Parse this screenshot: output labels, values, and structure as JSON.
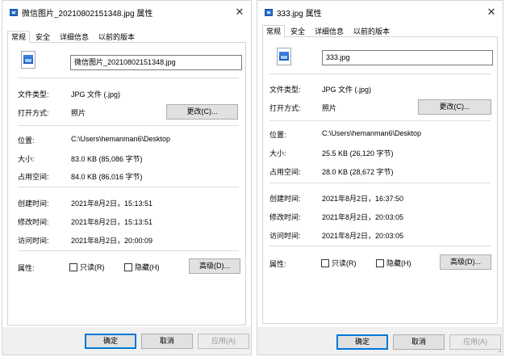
{
  "dialogs": [
    {
      "title": "微信图片_20210802151348.jpg 属性",
      "tabs": [
        "常规",
        "安全",
        "详细信息",
        "以前的版本"
      ],
      "active_tab": 0,
      "file_name": "微信图片_20210802151348.jpg",
      "file_type_label": "文件类型:",
      "file_type_value": "JPG 文件 (.jpg)",
      "open_with_label": "打开方式:",
      "open_with_value": "照片",
      "change_button": "更改(C)...",
      "location_label": "位置:",
      "location_value": "C:\\Users\\hemanman6\\Desktop",
      "size_label": "大小:",
      "size_value": "83.0 KB (85,086 字节)",
      "disk_size_label": "占用空间:",
      "disk_size_value": "84.0 KB (86,016 字节)",
      "created_label": "创建时间:",
      "created_value": "2021年8月2日，15:13:51",
      "modified_label": "修改时间:",
      "modified_value": "2021年8月2日，15:13:51",
      "accessed_label": "访问时间:",
      "accessed_value": "2021年8月2日，20:00:09",
      "attributes_label": "属性:",
      "readonly_label": "只读(R)",
      "hidden_label": "隐藏(H)",
      "advanced_button": "高级(D)...",
      "ok_button": "确定",
      "cancel_button": "取消",
      "apply_button": "应用(A)"
    },
    {
      "title": "333.jpg 属性",
      "tabs": [
        "常规",
        "安全",
        "详细信息",
        "以前的版本"
      ],
      "active_tab": 0,
      "file_name": "333.jpg",
      "file_type_label": "文件类型:",
      "file_type_value": "JPG 文件 (.jpg)",
      "open_with_label": "打开方式:",
      "open_with_value": "照片",
      "change_button": "更改(C)...",
      "location_label": "位置:",
      "location_value": "C:\\Users\\hemanman6\\Desktop",
      "size_label": "大小:",
      "size_value": "25.5 KB (26,120 字节)",
      "disk_size_label": "占用空间:",
      "disk_size_value": "28.0 KB (28,672 字节)",
      "created_label": "创建时间:",
      "created_value": "2021年8月2日，16:37:50",
      "modified_label": "修改时间:",
      "modified_value": "2021年8月2日，20:03:05",
      "accessed_label": "访问时间:",
      "accessed_value": "2021年8月2日，20:03:05",
      "attributes_label": "属性:",
      "readonly_label": "只读(R)",
      "hidden_label": "隐藏(H)",
      "advanced_button": "高级(D)...",
      "ok_button": "确定",
      "cancel_button": "取消",
      "apply_button": "应用(A)"
    }
  ],
  "colors": {
    "primary_button_border": "#0078d7",
    "button_face": "#e1e1e1",
    "separator": "#dcdcdc",
    "file_icon_blue": "#2b6fd1"
  },
  "icons": [
    "image-file-icon",
    "close-icon",
    "resize-grip-icon"
  ]
}
